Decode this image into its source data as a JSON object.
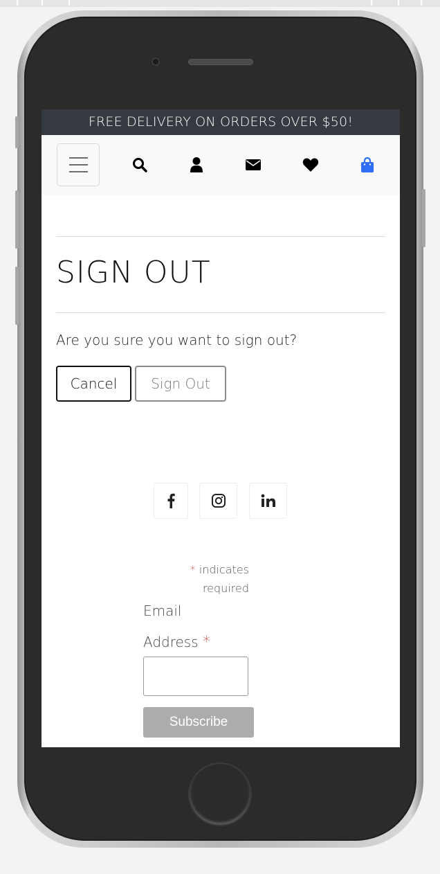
{
  "banner": {
    "text": "FREE DELIVERY ON ORDERS OVER $50!"
  },
  "navbar": {
    "icons": [
      "menu-icon",
      "search-icon",
      "user-icon",
      "envelope-icon",
      "heart-icon",
      "shopping-bag-icon"
    ],
    "cart_color": "#2f6df6"
  },
  "main": {
    "title": "SIGN OUT",
    "question": "Are you sure you want to sign out?",
    "cancel_label": "Cancel",
    "signout_label": "Sign Out"
  },
  "footer": {
    "social_icons": [
      "facebook-icon",
      "instagram-icon",
      "linkedin-icon"
    ],
    "required_star": "*",
    "required_note": "indicates required",
    "email_label": "Email Address",
    "email_star": "*",
    "email_value": "",
    "subscribe_label": "Subscribe"
  },
  "colors": {
    "banner_bg": "#343a40",
    "accent_blue": "#2f6df6",
    "required_red": "#c23a2a"
  }
}
